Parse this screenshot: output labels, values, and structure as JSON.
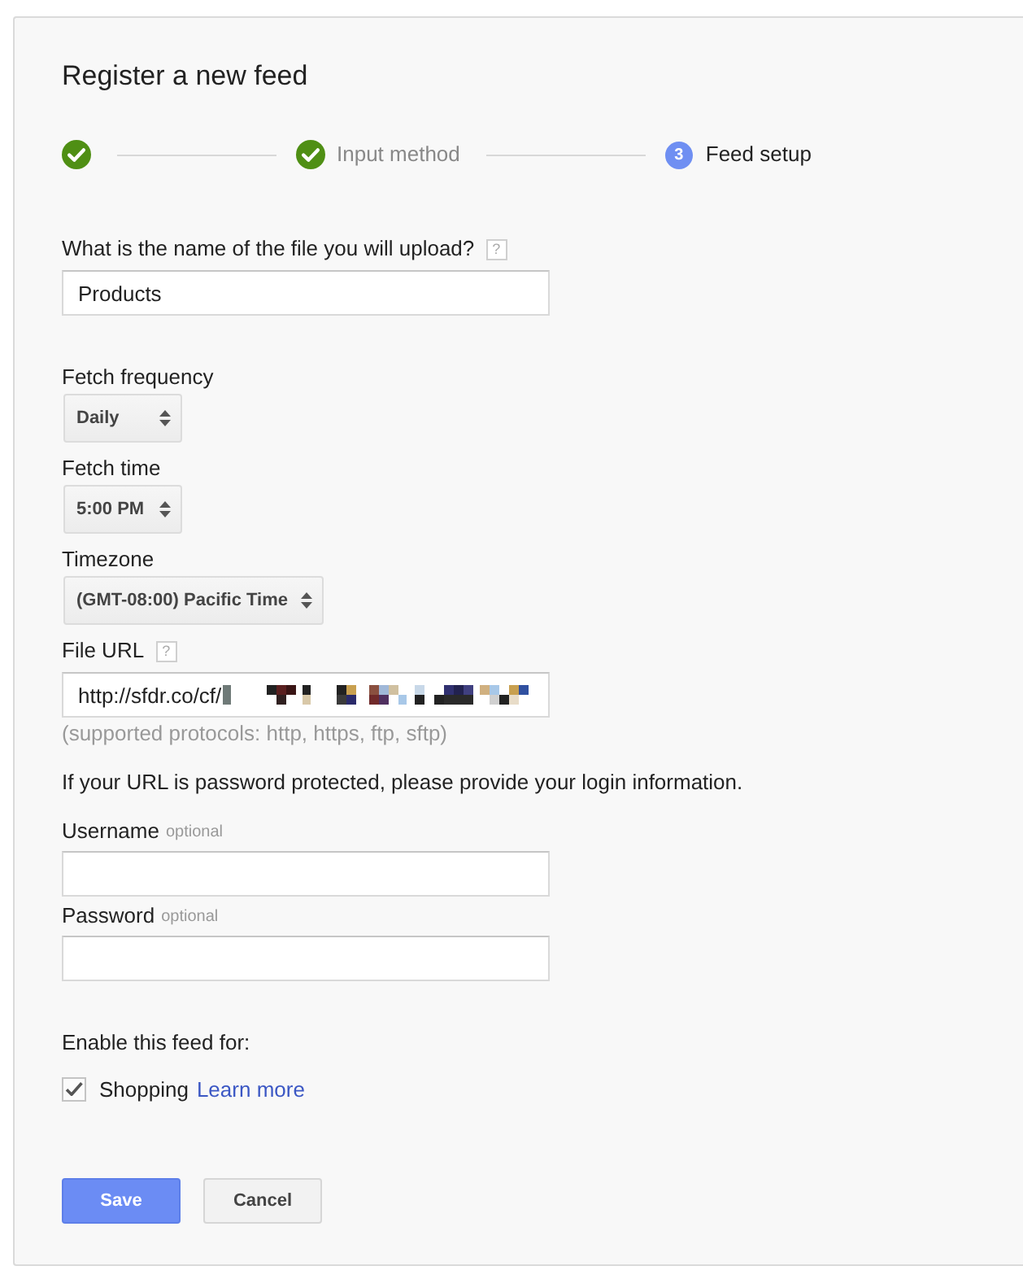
{
  "title": "Register a new feed",
  "steps": [
    {
      "completed": true
    },
    {
      "label": "Input method",
      "completed": true
    },
    {
      "number": "3",
      "label": "Feed setup",
      "completed": false
    }
  ],
  "sections": [
    {
      "fields": [
        {
          "kind": "text",
          "label": "What is the name of the file you will upload?",
          "help": "?",
          "value": "Products"
        }
      ]
    },
    {
      "fields": [
        {
          "kind": "select",
          "label": "Fetch frequency",
          "value": "Daily"
        },
        {
          "kind": "select",
          "label": "Fetch time",
          "value": "5:00 PM"
        },
        {
          "kind": "select",
          "label": "Timezone",
          "value": "(GMT-08:00) Pacific Time"
        },
        {
          "kind": "text",
          "label": "File URL",
          "help": "?",
          "value": "http://sfdr.co/cf/",
          "redacted": true,
          "note": "(supported protocols: http, https, ftp, sftp)"
        },
        {
          "kind": "paragraph",
          "text": "If your URL is password protected, please provide your login information."
        },
        {
          "kind": "text",
          "label": "Username",
          "hint": "optional"
        },
        {
          "kind": "text",
          "label": "Password",
          "hint": "optional"
        }
      ]
    },
    {
      "fields": [
        {
          "kind": "checklist",
          "label": "Enable this feed for:",
          "options": [
            {
              "label": "Shopping",
              "checked": true,
              "link": "Learn more"
            }
          ]
        }
      ]
    }
  ],
  "buttons": [
    {
      "label": "Save",
      "kind": "primary"
    },
    {
      "label": "Cancel",
      "kind": "secondary"
    }
  ]
}
